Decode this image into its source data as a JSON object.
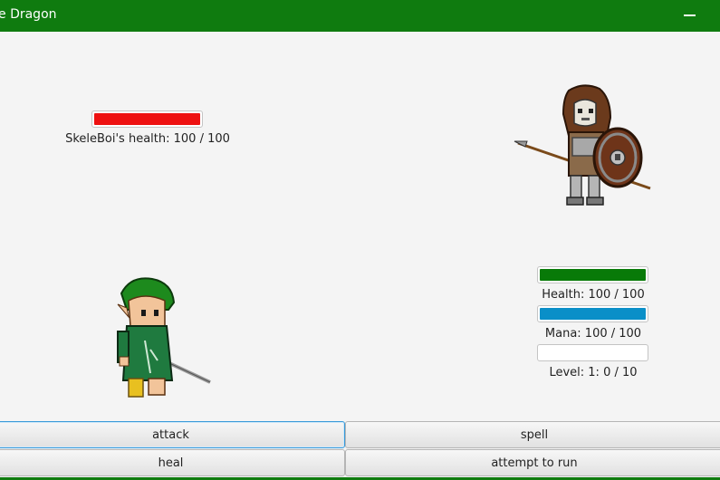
{
  "window": {
    "title": "e Dragon",
    "minimize_icon": "minimize-icon",
    "accent": "#0f7b0f"
  },
  "enemy": {
    "name": "SkeleBoi",
    "health_label": "SkeleBoi's health: 100 / 100",
    "health_fraction": 1.0,
    "health_color": "#ee1111",
    "sprite": "skeleton-spearman-sprite"
  },
  "player": {
    "sprite": "green-haired-hero-sprite",
    "health_label": "Health: 100 / 100",
    "health_fraction": 1.0,
    "health_color": "#087a08",
    "mana_label": "Mana: 100 / 100",
    "mana_fraction": 1.0,
    "mana_color": "#0a8fc8",
    "level_label": "Level: 1: 0 / 10",
    "level_fraction": 0.0
  },
  "actions": {
    "attack": "attack",
    "spell": "spell",
    "heal": "heal",
    "run": "attempt to run"
  }
}
